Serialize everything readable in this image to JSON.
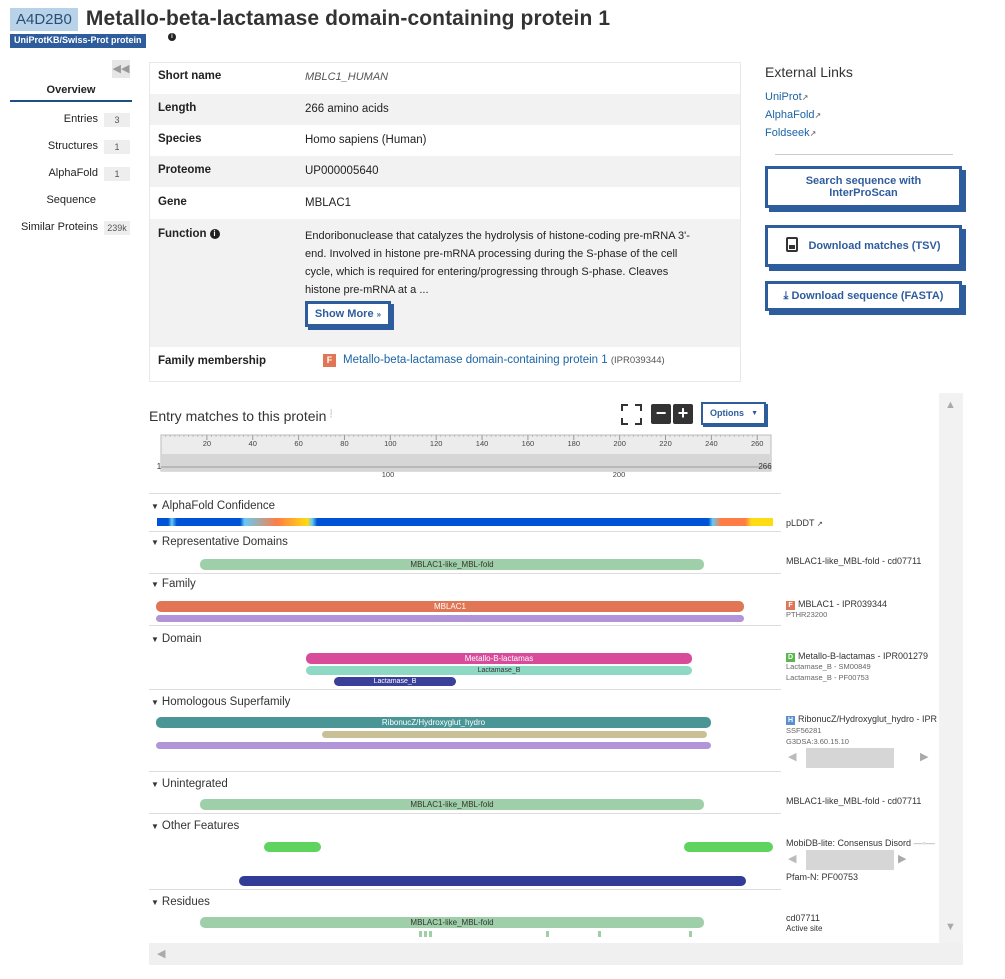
{
  "header": {
    "accession": "A4D2B0",
    "title": "Metallo-beta-lactamase domain-containing protein 1",
    "reviewed_badge": "UniProtKB/Swiss-Prot protein"
  },
  "nav": {
    "overview": "Overview",
    "items": [
      {
        "label": "Entries",
        "badge": "3"
      },
      {
        "label": "Structures",
        "badge": "1"
      },
      {
        "label": "AlphaFold",
        "badge": "1"
      },
      {
        "label": "Sequence",
        "badge": ""
      },
      {
        "label": "Similar Proteins",
        "badge": "239k"
      }
    ]
  },
  "overview": {
    "short_name": {
      "label": "Short name",
      "value": "MBLC1_HUMAN"
    },
    "length": {
      "label": "Length",
      "value": "266 amino acids"
    },
    "species": {
      "label": "Species",
      "value": "Homo sapiens (Human)"
    },
    "proteome": {
      "label": "Proteome",
      "value": "UP000005640"
    },
    "gene": {
      "label": "Gene",
      "value": "MBLAC1"
    },
    "function": {
      "label": "Function",
      "lines": [
        "Endoribonuclease that catalyzes the hydrolysis of histone-coding pre-mRNA 3'-",
        "end. Involved in histone pre-mRNA processing during the S-phase of the cell",
        "cycle, which is required for entering/progressing through S-phase. Cleaves",
        "histone pre-mRNA at a ..."
      ],
      "show_more": "Show More"
    },
    "family": {
      "label": "Family membership",
      "badge": "F",
      "name": "Metallo-beta-lactamase domain-containing protein 1",
      "id": "(IPR039344)"
    }
  },
  "external": {
    "title": "External Links",
    "links": [
      "UniProt",
      "AlphaFold",
      "Foldseek"
    ],
    "buttons": {
      "interproscan": [
        "Search sequence with",
        "InterProScan"
      ],
      "download_tsv": "Download matches (TSV)",
      "download_fasta": "Download sequence (FASTA)"
    }
  },
  "entry_matches": {
    "title": "Entry matches to this protein",
    "options": "Options",
    "ruler": {
      "ticks": [
        "20",
        "40",
        "60",
        "80",
        "100",
        "120",
        "140",
        "160",
        "180",
        "200",
        "220",
        "240",
        "260"
      ],
      "start": "1",
      "end": "266",
      "overview_ticks": [
        "100",
        "200"
      ]
    },
    "tracks": {
      "alphafold": {
        "label": "AlphaFold Confidence",
        "right": "pLDDT"
      },
      "representative": {
        "label": "Representative Domains",
        "bar": "MBLAC1-like_MBL-fold",
        "right": "MBLAC1-like_MBL-fold - cd07711"
      },
      "family": {
        "label": "Family",
        "bar": "MBLAC1",
        "right_badge": "F",
        "right": "MBLAC1 - IPR039344",
        "right_sub": "PTHR23200"
      },
      "domain": {
        "label": "Domain",
        "bars": [
          "Metallo-B-lactamas",
          "Lactamase_B",
          "Lactamase_B"
        ],
        "right_badge": "D",
        "right": "Metallo-B-lactamas - IPR001279",
        "right_sub": [
          "Lactamase_B - SM00849",
          "Lactamase_B - PF00753"
        ]
      },
      "homologous": {
        "label": "Homologous Superfamily",
        "bar": "RibonucZ/Hydroxyglut_hydro",
        "right_badge": "H",
        "right": "RibonucZ/Hydroxyglut_hydro - IPR",
        "right_sub": [
          "SSF56281",
          "G3DSA:3.60.15.10"
        ]
      },
      "unintegrated": {
        "label": "Unintegrated",
        "bar": "MBLAC1-like_MBL-fold",
        "right": "MBLAC1-like_MBL-fold - cd07711"
      },
      "other": {
        "label": "Other Features",
        "right": "MobiDB-lite: Consensus Disord",
        "right2": "Pfam-N: PF00753"
      },
      "residues": {
        "label": "Residues",
        "bar": "MBLAC1-like_MBL-fold",
        "right": "cd07711",
        "right_sub": "Active site"
      }
    }
  },
  "colors": {
    "accent": "#2e5d9d",
    "representative": "#9fcfa8",
    "family_orange": "#e07656",
    "family_purple": "#b195d8",
    "domain_pink": "#d84a9a",
    "domain_teal": "#8ed9c4",
    "domain_navy": "#3a3f99",
    "homologous_teal": "#4a9596",
    "homologous_tan": "#c9c095",
    "mobidb_green": "#5ed35e",
    "pfam_n_navy": "#323c96"
  }
}
